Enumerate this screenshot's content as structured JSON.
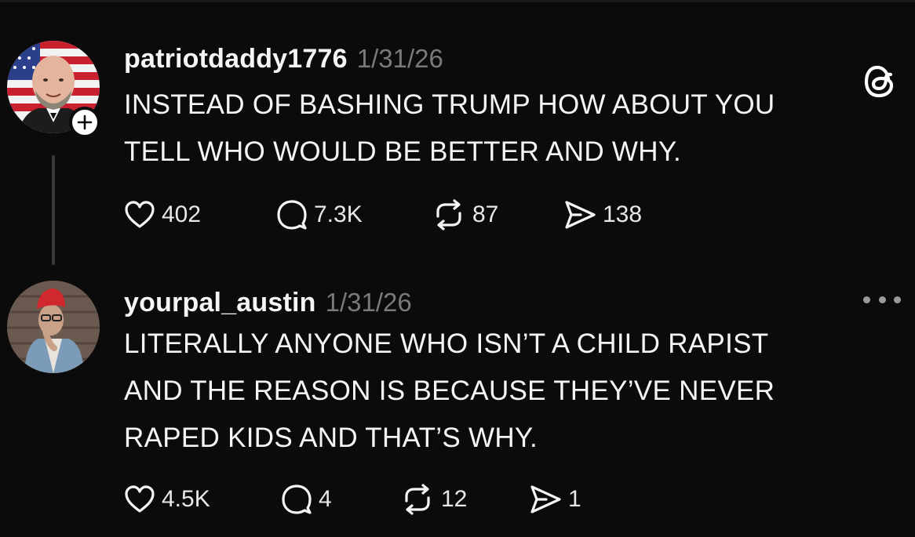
{
  "posts": [
    {
      "username": "patriotdaddy1776",
      "date": "1/31/26",
      "text_lines": [
        "INSTEAD OF BASHING TRUMP HOW ABOUT YOU",
        "TELL WHO WOULD BE BETTER AND WHY."
      ],
      "likes": "402",
      "replies": "7.3K",
      "reposts": "87",
      "shares": "138"
    },
    {
      "username": "yourpal_austin",
      "date": "1/31/26",
      "text_lines": [
        "LITERALLY ANYONE WHO ISN’T A CHILD RAPIST",
        "AND THE REASON IS BECAUSE THEY’VE NEVER",
        "RAPED KIDS AND THAT’S WHY."
      ],
      "likes": "4.5K",
      "replies": "4",
      "reposts": "12",
      "shares": "1"
    }
  ],
  "icons": {
    "app_logo": "threads-logo-icon",
    "follow": "plus-icon",
    "like": "heart-icon",
    "reply": "comment-icon",
    "repost": "repost-icon",
    "share": "send-icon",
    "more": "more-options-icon"
  },
  "colors": {
    "background": "#0b0b0b",
    "text": "#f3f5f7",
    "muted": "#7a7a7a"
  }
}
